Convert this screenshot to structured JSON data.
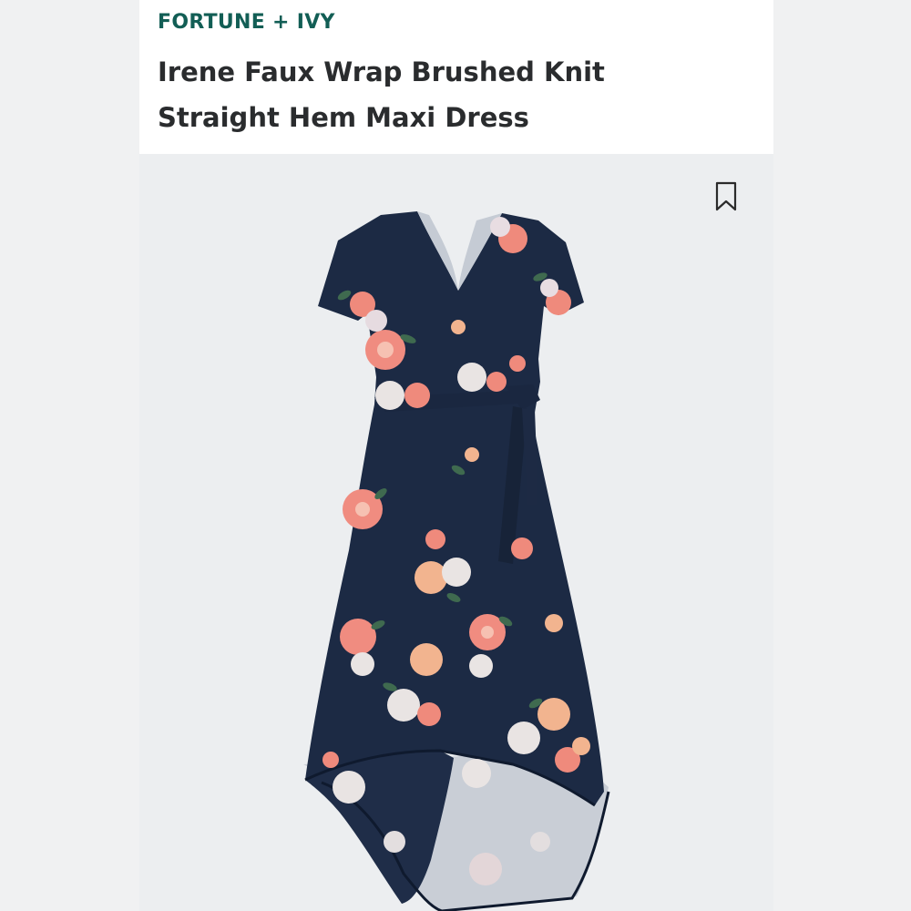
{
  "product": {
    "brand": "FORTUNE + IVY",
    "title_line1": "Irene Faux Wrap Brushed Knit",
    "title_line2": "Straight Hem Maxi Dress"
  },
  "icons": {
    "bookmark": "bookmark-icon"
  },
  "colors": {
    "brand": "#125e55",
    "title": "#2a2c2e",
    "dress_navy": "#1c2a44",
    "lining": "#c9ced6",
    "flower_coral": "#ef8a7c",
    "flower_peach": "#f2b48f",
    "flower_white": "#e9e4e3"
  }
}
